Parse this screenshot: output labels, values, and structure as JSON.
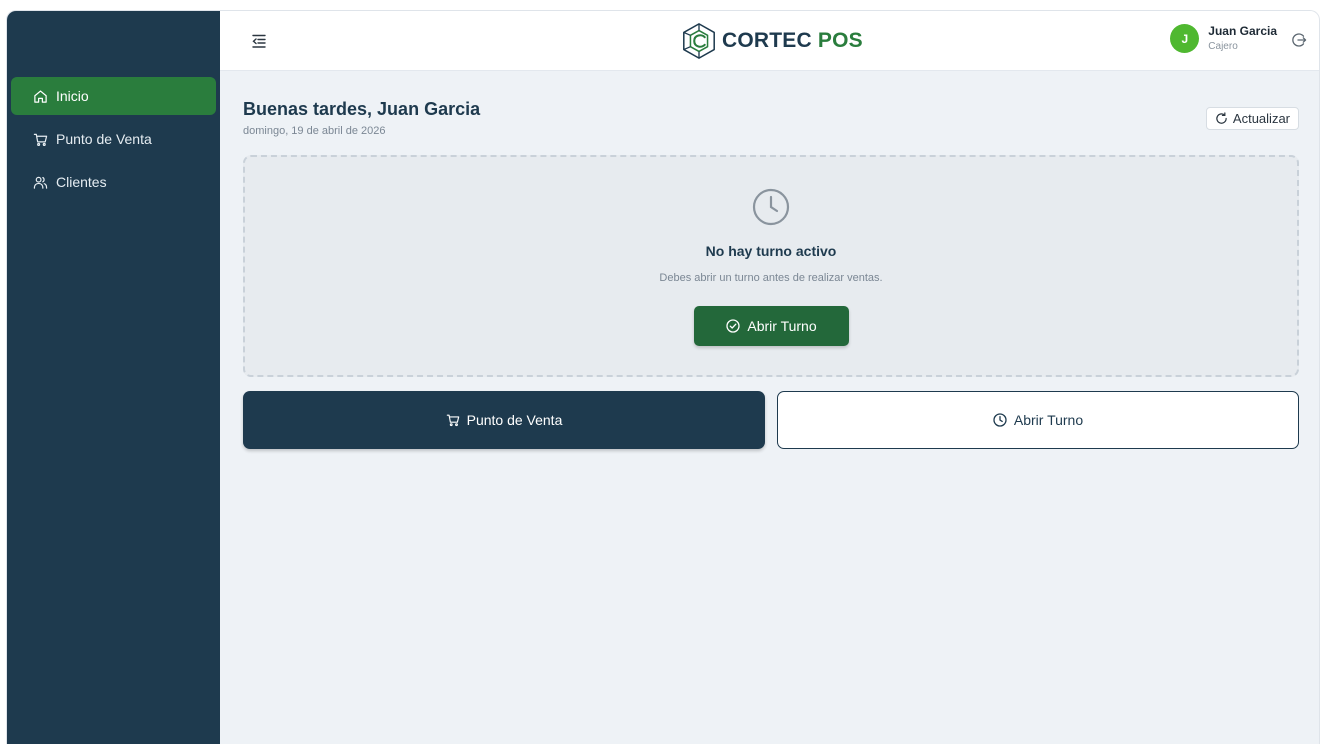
{
  "app": {
    "brand_part1": "CORTEC",
    "brand_part2": "POS"
  },
  "sidebar": {
    "items": [
      {
        "label": "Inicio",
        "icon": "home-icon",
        "active": true
      },
      {
        "label": "Punto de Venta",
        "icon": "cart-icon",
        "active": false
      },
      {
        "label": "Clientes",
        "icon": "users-icon",
        "active": false
      }
    ]
  },
  "header": {
    "user": {
      "initial": "J",
      "name": "Juan Garcia",
      "role": "Cajero"
    }
  },
  "main": {
    "greeting": "Buenas tardes, Juan Garcia",
    "date": "domingo, 19 de abril de 2026",
    "refresh_label": "Actualizar",
    "empty_state": {
      "title": "No hay turno activo",
      "subtitle": "Debes abrir un turno antes de realizar ventas.",
      "button_label": "Abrir Turno"
    },
    "actions": [
      {
        "label": "Punto de Venta",
        "icon": "cart-icon"
      },
      {
        "label": "Abrir Turno",
        "icon": "clock-icon"
      }
    ]
  },
  "colors": {
    "sidebar_bg": "#1e3a4e",
    "active_nav": "#2a7d3d",
    "primary_button": "#23683a",
    "avatar": "#4fb830",
    "page_bg": "#eef2f6"
  }
}
